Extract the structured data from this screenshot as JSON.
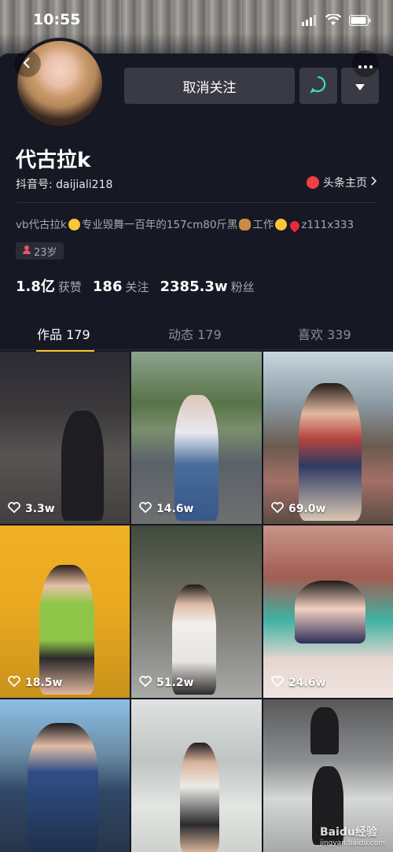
{
  "status_bar": {
    "time": "10:55"
  },
  "header": {
    "unfollow_label": "取消关注"
  },
  "profile": {
    "name": "代古拉k",
    "douyin_id": "抖音号: daijiali218",
    "headline_link": "头条主页",
    "bio_parts": [
      "vb代古拉k",
      "专业毁舞一百年的157cm80斤黑",
      "工作",
      "z111x333"
    ],
    "age": "23岁"
  },
  "stats": [
    {
      "value": "1.8亿",
      "label": "获赞"
    },
    {
      "value": "186",
      "label": "关注"
    },
    {
      "value": "2385.3w",
      "label": "粉丝"
    }
  ],
  "tabs": [
    {
      "label": "作品 179",
      "active": true
    },
    {
      "label": "动态 179",
      "active": false
    },
    {
      "label": "喜欢 339",
      "active": false
    }
  ],
  "videos": [
    {
      "likes": "3.3w"
    },
    {
      "likes": "14.6w"
    },
    {
      "likes": "69.0w"
    },
    {
      "likes": "18.5w"
    },
    {
      "likes": "51.2w"
    },
    {
      "likes": "24.6w"
    },
    {
      "likes": ""
    },
    {
      "likes": ""
    },
    {
      "likes": ""
    }
  ],
  "watermark": {
    "brand": "Baidu经验",
    "url": "jingyan.baidu.com"
  },
  "colors": {
    "background": "#161823",
    "accent": "#f5c531",
    "button": "#3a3a44",
    "text_secondary": "#a7a8ae"
  }
}
